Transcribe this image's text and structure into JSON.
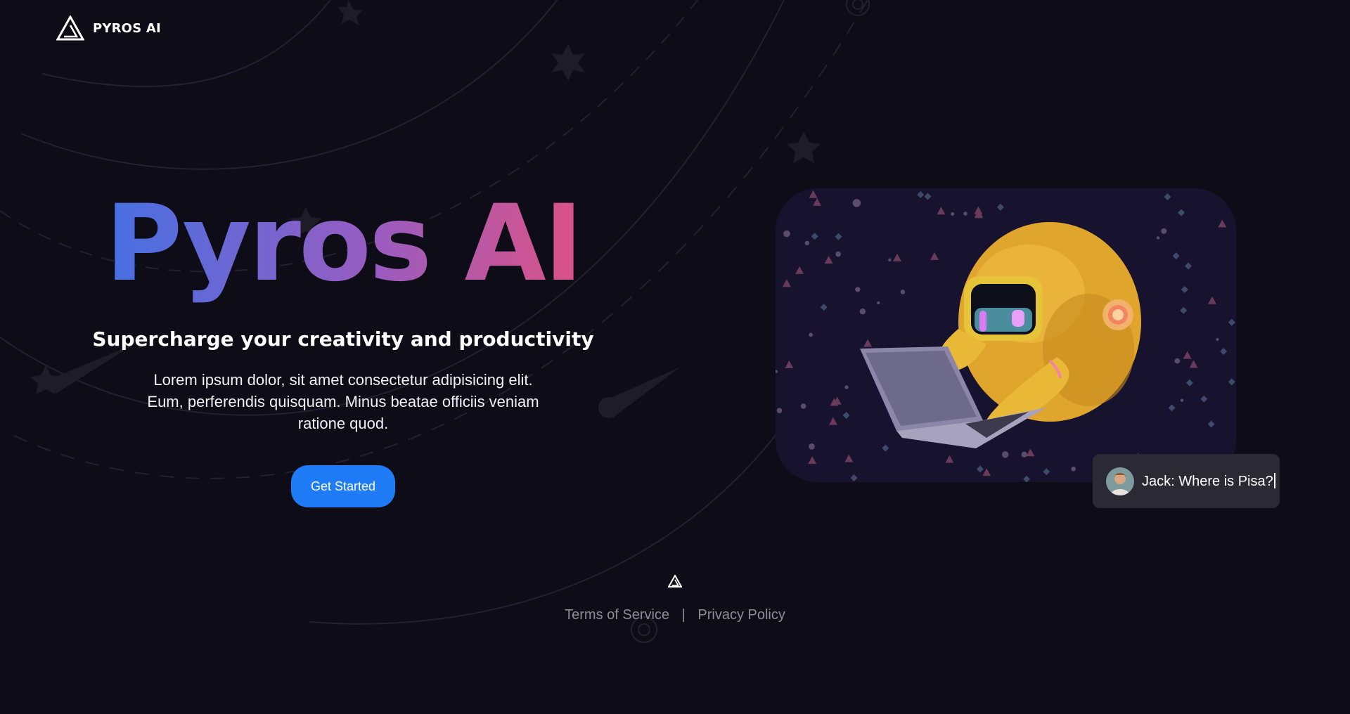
{
  "header": {
    "brand_name": "PYROS AI",
    "logo_icon": "pyros-triangle-logo-icon"
  },
  "hero": {
    "title": "Pyros AI",
    "subtitle": "Supercharge your creativity and productivity",
    "description": "Lorem ipsum dolor, sit amet consectetur adipisicing elit. Eum, perferendis quisquam. Minus beatae officiis veniam ratione quod.",
    "cta_label": "Get Started",
    "title_gradient": [
      "#2a78f2",
      "#9a5cc0",
      "#ea4b62"
    ]
  },
  "illustration": {
    "subject": "robot-mascot-with-laptop",
    "background_color": "#17122e"
  },
  "chat_bubble": {
    "text": "Jack: Where is Pisa?",
    "avatar_icon": "user-avatar-icon"
  },
  "footer": {
    "links": [
      {
        "label": "Terms of Service"
      },
      {
        "label": "Privacy Policy"
      }
    ],
    "separator": "|"
  },
  "colors": {
    "background": "#0e0c16",
    "accent": "#1f7bf6",
    "chat_bg": "#2b2a34",
    "footer_text": "#8e8c98"
  }
}
